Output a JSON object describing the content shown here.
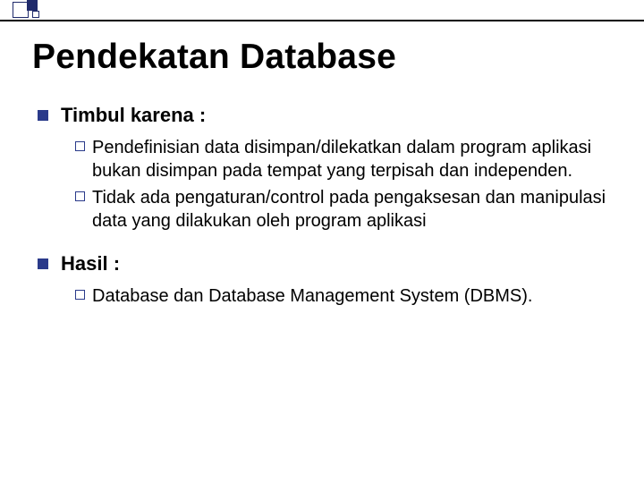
{
  "title": "Pendekatan Database",
  "sections": [
    {
      "heading": "Timbul karena :",
      "items": [
        "Pendefinisian data disimpan/dilekatkan dalam program aplikasi bukan disimpan pada tempat yang terpisah dan independen.",
        "Tidak ada pengaturan/control pada pengaksesan dan manipulasi data yang dilakukan oleh program aplikasi"
      ]
    },
    {
      "heading": "Hasil :",
      "items": [
        "Database dan Database Management System (DBMS)."
      ]
    }
  ]
}
